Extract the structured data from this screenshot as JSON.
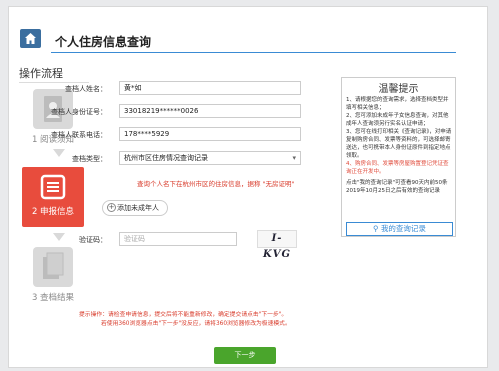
{
  "header": {
    "title": "个人住房信息查询"
  },
  "flow": {
    "title": "操作流程",
    "steps": [
      {
        "label": "1 阅读须知"
      },
      {
        "label": "2 申报信息"
      },
      {
        "label": "3 查档结果"
      }
    ]
  },
  "form": {
    "name_label": "查档人姓名：",
    "name_value": "黄*如",
    "id_label": "查档人身份证号：",
    "id_value": "33018219******0026",
    "phone_label": "查档人联系电话：",
    "phone_value": "178****5929",
    "type_label": "查档类型：",
    "type_value": "杭州市区住房情况查询记录",
    "hint": "查询个人名下在杭州市区的住房信息，据称 \"无房证明\"",
    "add_button": "添加未成年人",
    "captcha_label": "验证码：",
    "captcha_placeholder": "验证码",
    "captcha_text": "I-KVG"
  },
  "tips": {
    "title": "温馨提示",
    "lines": [
      "1、请根据您的查询需求，选择查档类型并填写相关信息；",
      "2、您可添加未成年子女信息查询，对其他成年人查询须另行实名认证申请；",
      "3、您可在线打印相关《查询记录》，对申请复制购房合同、发票等资料的，可选择邮寄送达，也可携带本人身份证原件到指定地点领取。"
    ],
    "red_lines": [
      "4、购房合同、发票等房屋购置登记凭证查询正在开发中。"
    ],
    "footer": "点击\"我的查询记录\"可查看90天内前50条2019年10月25日之后有效的查询记录",
    "query_button": "我的查询记录"
  },
  "notice": {
    "line1": "提示操作：请检查申请信息，提交后将不能重新修改，确定提交请点击\"下一步\"。",
    "line2": "若使用360浏览器点击\"下一步\"没反应，请将360浏览器修改为极速模式。"
  },
  "next_button": "下一步",
  "colors": {
    "accent": "#3a8bd4",
    "active_step": "#e84c3d",
    "next_button": "#4aa52c",
    "warning": "#d83a2a"
  }
}
